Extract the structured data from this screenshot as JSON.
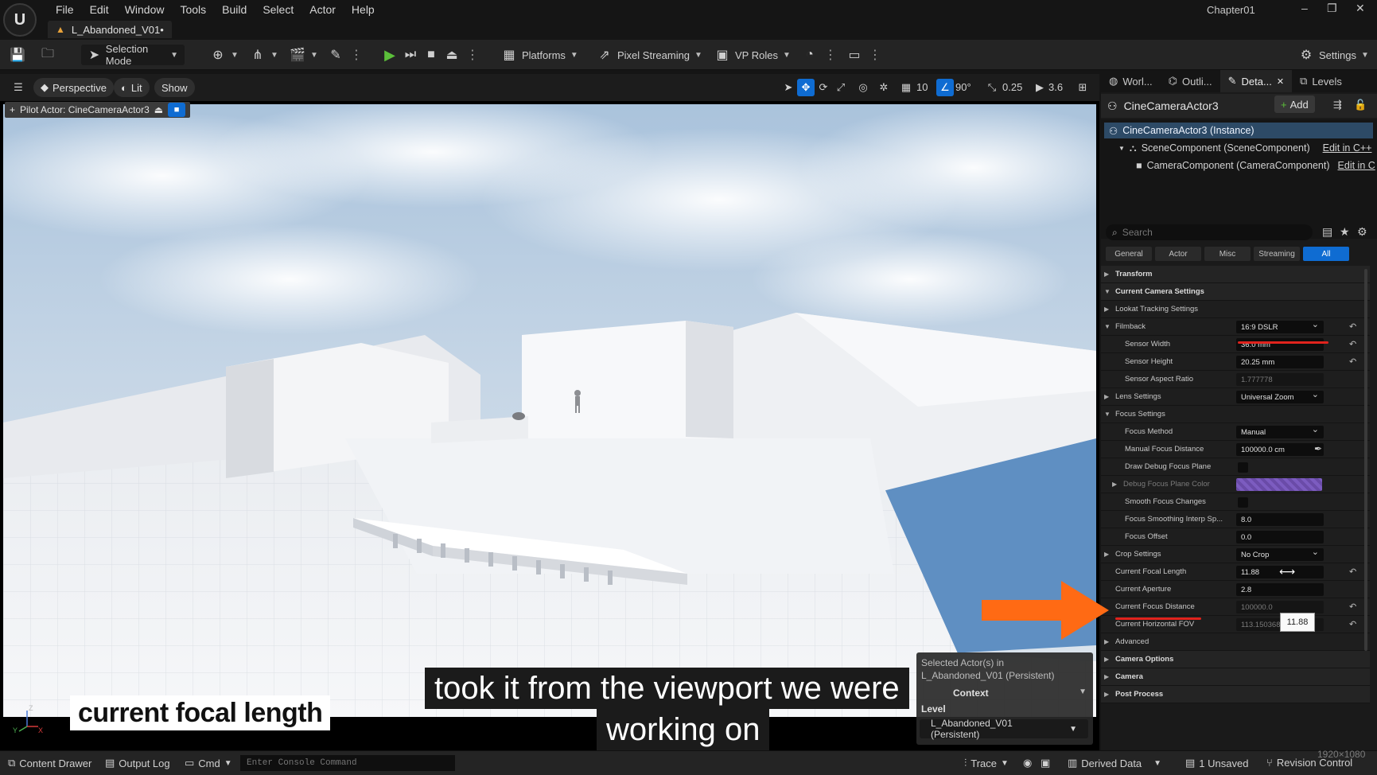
{
  "app": {
    "menu": [
      "File",
      "Edit",
      "Window",
      "Tools",
      "Build",
      "Select",
      "Actor",
      "Help"
    ],
    "level_tab": "L_Abandoned_V01•",
    "project": "Chapter01",
    "window_controls": [
      "–",
      "❐",
      "✕"
    ]
  },
  "toolbar": {
    "selection_mode": "Selection Mode",
    "platforms": "Platforms",
    "pixel_streaming": "Pixel Streaming",
    "vp_roles": "VP Roles",
    "settings": "Settings"
  },
  "viewport": {
    "perspective": "Perspective",
    "lit": "Lit",
    "show": "Show",
    "grid_snap": "10",
    "angle_snap": "90°",
    "scale_snap": "0.25",
    "camera_speed": "3.6",
    "pilot_label": "Pilot Actor: CineCameraActor3",
    "selected_popup": {
      "line1": "Selected Actor(s) in",
      "line2": "L_Abandoned_V01 (Persistent)",
      "context": "Context",
      "level_label": "Level",
      "level_value": "L_Abandoned_V01 (Persistent)"
    },
    "caption_left": "current focal length",
    "caption_line1": "took it from the viewport we were",
    "caption_line2": "working on"
  },
  "panel": {
    "tabs": [
      "Worl...",
      "Outli...",
      "Deta...",
      "Levels"
    ],
    "actor_name": "CineCameraActor3",
    "add_label": "Add",
    "components": {
      "instance": "CineCameraActor3 (Instance)",
      "scene": "SceneComponent (SceneComponent)",
      "scene_edit": "Edit in C++",
      "camera": "CameraComponent (CameraComponent)",
      "camera_edit": "Edit in C"
    },
    "search_placeholder": "Search",
    "filters": [
      "General",
      "Actor",
      "Misc",
      "Streaming",
      "All"
    ],
    "properties": [
      {
        "label": "Transform",
        "type": "section",
        "arrow": "▶"
      },
      {
        "label": "Current Camera Settings",
        "type": "section",
        "arrow": "▼"
      },
      {
        "label": "Lookat Tracking Settings",
        "type": "sub",
        "arrow": "▶"
      },
      {
        "label": "Filmback",
        "type": "sub",
        "arrow": "▼",
        "value": "16:9 DSLR",
        "drop": true,
        "reset": true
      },
      {
        "label": "Sensor Width",
        "type": "indent",
        "value": "36.0 mm",
        "reset": true
      },
      {
        "label": "Sensor Height",
        "type": "indent",
        "value": "20.25 mm",
        "reset": true
      },
      {
        "label": "Sensor Aspect Ratio",
        "type": "indent",
        "value": "1.777778",
        "disabled": true
      },
      {
        "label": "Lens Settings",
        "type": "sub",
        "arrow": "▶",
        "value": "Universal Zoom",
        "drop": true
      },
      {
        "label": "Focus Settings",
        "type": "sub",
        "arrow": "▼"
      },
      {
        "label": "Focus Method",
        "type": "indent",
        "value": "Manual",
        "drop": true
      },
      {
        "label": "Manual Focus Distance",
        "type": "indent",
        "value": "100000.0 cm",
        "picker": true
      },
      {
        "label": "Draw Debug Focus Plane",
        "type": "indent",
        "check": true
      },
      {
        "label": "Debug Focus Plane Color",
        "type": "indent",
        "arrow": "▶",
        "color": true,
        "dim": true
      },
      {
        "label": "Smooth Focus Changes",
        "type": "indent",
        "check": true
      },
      {
        "label": "Focus Smoothing Interp Sp...",
        "type": "indent",
        "value": "8.0"
      },
      {
        "label": "Focus Offset",
        "type": "indent",
        "value": "0.0"
      },
      {
        "label": "Crop Settings",
        "type": "sub",
        "arrow": "▶",
        "value": "No Crop",
        "drop": true
      },
      {
        "label": "Current Focal Length",
        "type": "sub",
        "value": "11.88",
        "reset": true
      },
      {
        "label": "Current Aperture",
        "type": "sub",
        "value": "2.8"
      },
      {
        "label": "Current Focus Distance",
        "type": "sub",
        "value": "100000.0",
        "disabled": true,
        "reset": true
      },
      {
        "label": "Current Horizontal FOV",
        "type": "sub",
        "value": "113.150368",
        "disabled": true,
        "reset": true
      },
      {
        "label": "Advanced",
        "type": "sub",
        "arrow": "▶"
      },
      {
        "label": "Camera Options",
        "type": "section",
        "arrow": "▶"
      },
      {
        "label": "Camera",
        "type": "section",
        "arrow": "▶"
      },
      {
        "label": "Post Process",
        "type": "section",
        "arrow": "▶"
      }
    ],
    "tooltip": "11.88"
  },
  "statusbar": {
    "content_drawer": "Content Drawer",
    "output_log": "Output Log",
    "cmd": "Cmd",
    "console_placeholder": "Enter Console Command",
    "trace": "Trace",
    "derived_data": "Derived Data",
    "unsaved": "1 Unsaved",
    "revision_control": "Revision Control",
    "resolution": "1920×1080"
  },
  "colors": {
    "accent": "#0f6cd2",
    "play_green": "#5bbf3a",
    "annotation_red": "#e0231d",
    "annotation_orange": "#ff6a14"
  }
}
